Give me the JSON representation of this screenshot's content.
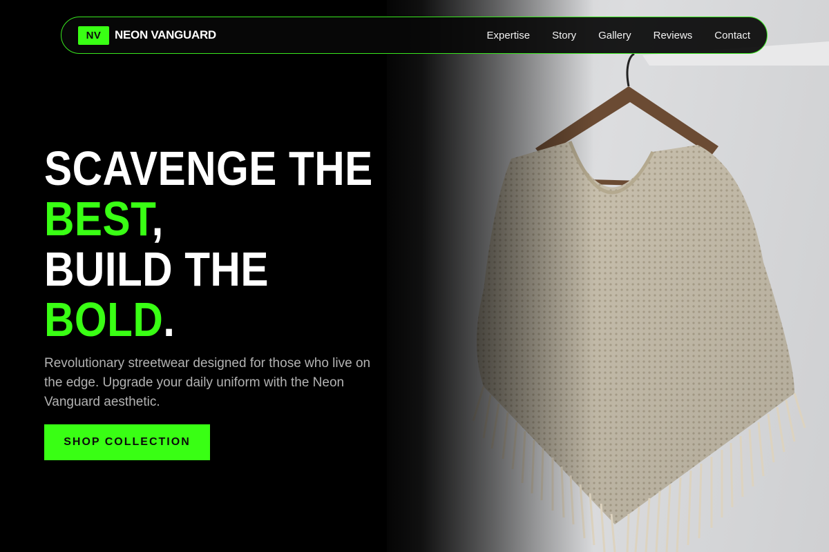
{
  "brand": {
    "badge": "NV",
    "name": "NEON VANGUARD"
  },
  "nav": {
    "items": [
      {
        "label": "Expertise"
      },
      {
        "label": "Story"
      },
      {
        "label": "Gallery"
      },
      {
        "label": "Reviews"
      },
      {
        "label": "Contact"
      }
    ]
  },
  "hero": {
    "headline": {
      "line1": "SCAVENGE THE",
      "line2_accent": "BEST",
      "line2_punct": ",",
      "line3": "BUILD THE",
      "line4_accent": "BOLD",
      "line4_punct": "."
    },
    "description": "Revolutionary streetwear designed for those who live on the edge. Upgrade your daily uniform with the Neon Vanguard aesthetic.",
    "cta_label": "SHOP COLLECTION"
  },
  "colors": {
    "accent": "#39ff14",
    "background": "#000000",
    "text": "#ffffff",
    "muted": "#b3b3b3"
  },
  "image": {
    "subject": "knit-poncho-on-hanger"
  }
}
